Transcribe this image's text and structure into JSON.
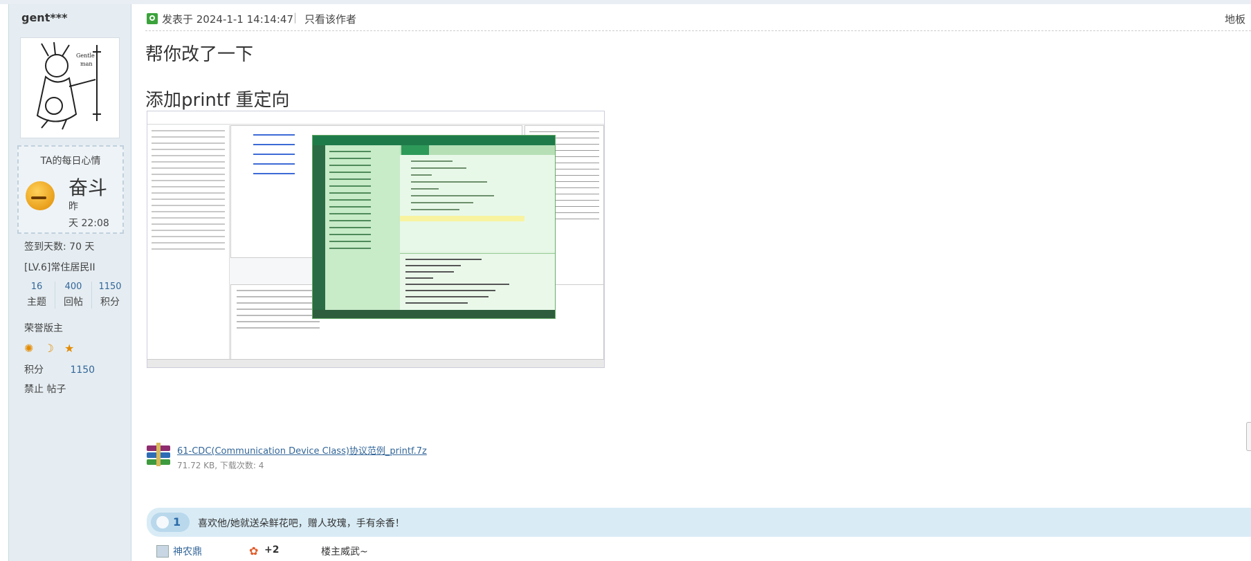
{
  "sidebar": {
    "username": "gent***",
    "mood": {
      "title": "TA的每日心情",
      "text": "奋斗",
      "time_line1": "昨",
      "time_line2": "天 22:08",
      "icon": "mood-struggle-icon"
    },
    "signin": "签到天数: 70 天",
    "level": "[LV.6]常住居民II",
    "stats": [
      {
        "value": "16",
        "label": "主题"
      },
      {
        "value": "400",
        "label": "回帖"
      },
      {
        "value": "1150",
        "label": "积分"
      }
    ],
    "honor_title": "荣誉版主",
    "medals": [
      "sun-icon",
      "moon-icon",
      "star-icon"
    ],
    "jifen_label": "积分",
    "jifen_value": "1150",
    "ban": "禁止 帖子"
  },
  "post": {
    "header": {
      "posted": "发表于 2024-1-1 14:14:47",
      "sep": "|",
      "only_author": "只看该作者",
      "floor": "地板"
    },
    "line1": "帮你改了一下",
    "line2": "添加printf 重定向",
    "attachment": {
      "name": "61-CDC(Communication Device Class)协议范例_printf.7z",
      "meta": "71.72 KB, 下载次数: 4",
      "icon": "winrar-archive-icon"
    }
  },
  "rating": {
    "count": "1",
    "text": "喜欢他/她就送朵鲜花吧，赠人玫瑰，手有余香！",
    "rows": [
      {
        "user": "神农鼎",
        "score": "+2",
        "comment": "楼主威武~"
      }
    ]
  }
}
